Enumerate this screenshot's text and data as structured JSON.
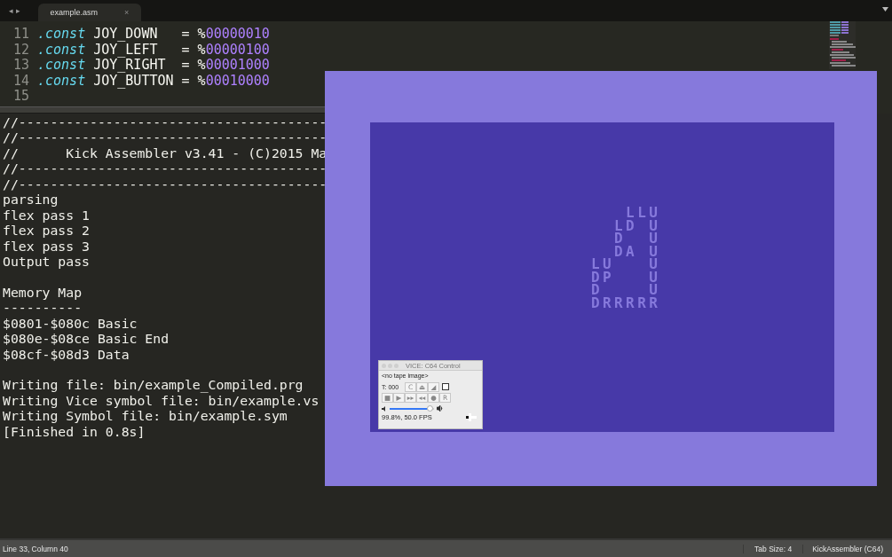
{
  "tab_bar": {
    "nav": "◂ ▸",
    "tabs": [
      {
        "label": "example.asm",
        "close": "×",
        "selected": true
      }
    ]
  },
  "editor": {
    "lines": [
      {
        "number": "11",
        "keyword": ".const",
        "name": "JOY_DOWN",
        "operator": "=",
        "prefix": "%",
        "value": "00000010"
      },
      {
        "number": "12",
        "keyword": ".const",
        "name": "JOY_LEFT",
        "operator": "=",
        "prefix": "%",
        "value": "00000100"
      },
      {
        "number": "13",
        "keyword": ".const",
        "name": "JOY_RIGHT",
        "operator": "=",
        "prefix": "%",
        "value": "00001000"
      },
      {
        "number": "14",
        "keyword": ".const",
        "name": "JOY_BUTTON",
        "operator": "=",
        "prefix": "%",
        "value": "00010000"
      },
      {
        "number": "15"
      }
    ]
  },
  "build_output": {
    "lines": [
      {
        "text": "//---------------------------------------"
      },
      {
        "text": "//---------------------------------------"
      },
      {
        "text": "//      Kick Assembler v3.41 - (C)2015 Ma"
      },
      {
        "text": "//---------------------------------------"
      },
      {
        "text": "//---------------------------------------"
      },
      {
        "text": "parsing"
      },
      {
        "text": "flex pass 1"
      },
      {
        "text": "flex pass 2"
      },
      {
        "text": "flex pass 3"
      },
      {
        "text": "Output pass"
      },
      {
        "text": "Memory Map",
        "blank_before": true
      },
      {
        "text": "----------"
      },
      {
        "text": "$0801-$080c Basic"
      },
      {
        "text": "$080e-$08ce Basic End"
      },
      {
        "text": "$08cf-$08d3 Data"
      },
      {
        "text": "Writing file: bin/example_Compiled.prg",
        "blank_before": true
      },
      {
        "text": "Writing Vice symbol file: bin/example.vs"
      },
      {
        "text": "Writing Symbol file: bin/example.sym"
      },
      {
        "text": "[Finished in 0.8s]"
      }
    ]
  },
  "emulator": {
    "screen_rows": [
      "   LLU",
      "  LD U",
      "  D  U",
      "  DA U",
      "LU   U",
      "DP   U",
      "D    U",
      "DRRRRR"
    ]
  },
  "vice_control": {
    "title": "VICE: C64 Control",
    "tape": "<no tape image>",
    "counter": "T: 000",
    "row1_buttons": [
      {
        "label": "C",
        "disabled": true
      },
      {
        "label": "⏏",
        "disabled": true
      },
      {
        "label": "◢",
        "disabled": true
      }
    ],
    "record_checkbox": {
      "checked": false
    },
    "row2_buttons": [
      {
        "label": "■",
        "disabled": true
      },
      {
        "label": "▶",
        "disabled": true
      },
      {
        "label": "▸▸",
        "disabled": true
      },
      {
        "label": "◂◂",
        "disabled": true
      },
      {
        "label": "●",
        "disabled": true
      },
      {
        "label": "R",
        "disabled": true
      }
    ],
    "volume": {
      "level": 0.92
    },
    "status": "99.8%, 50.0 FPS"
  },
  "status_bar": {
    "position": "Line 33, Column 40",
    "tab_size": "Tab Size: 4",
    "syntax": "KickAssembler (C64)"
  }
}
